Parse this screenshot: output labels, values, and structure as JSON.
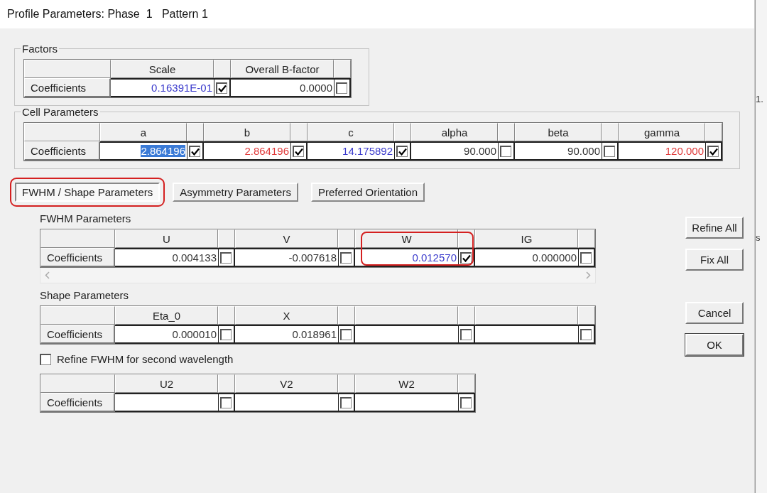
{
  "window": {
    "title": "Profile Parameters: Phase  1   Pattern 1"
  },
  "factors": {
    "title": "Factors",
    "row_label": "Coefficients",
    "columns": [
      {
        "label": "Scale",
        "value": "0.16391E-01",
        "color": "#3a3acc",
        "checked": true,
        "selected": false
      },
      {
        "label": "Overall B-factor",
        "value": "0.0000",
        "color": "#333333",
        "checked": false,
        "selected": false
      }
    ]
  },
  "cell_parameters": {
    "title": "Cell Parameters",
    "row_label": "Coefficients",
    "columns": [
      {
        "label": "a",
        "value": "2.864196",
        "checked": true,
        "selected": true
      },
      {
        "label": "b",
        "value": "2.864196",
        "color": "#e03a3a",
        "checked": true,
        "selected": false
      },
      {
        "label": "c",
        "value": "14.175892",
        "color": "#3a3acc",
        "checked": true,
        "selected": false
      },
      {
        "label": "alpha",
        "value": "90.000",
        "color": "#333333",
        "checked": false,
        "selected": false
      },
      {
        "label": "beta",
        "value": "90.000",
        "color": "#333333",
        "checked": false,
        "selected": false
      },
      {
        "label": "gamma",
        "value": "120.000",
        "color": "#e03a3a",
        "checked": true,
        "selected": false
      }
    ]
  },
  "tabs": [
    {
      "label": "FWHM / Shape Parameters",
      "selected": true,
      "annotated": true
    },
    {
      "label": "Asymmetry Parameters",
      "selected": false,
      "annotated": false
    },
    {
      "label": "Preferred Orientation",
      "selected": false,
      "annotated": false
    }
  ],
  "fwhm": {
    "title": "FWHM Parameters",
    "row_label": "Coefficients",
    "columns": [
      {
        "label": "U",
        "value": "0.004133",
        "color": "#333333",
        "checked": false,
        "annotated": false
      },
      {
        "label": "V",
        "value": "-0.007618",
        "color": "#333333",
        "checked": false,
        "annotated": false
      },
      {
        "label": "W",
        "value": "0.012570",
        "color": "#3a3acc",
        "checked": true,
        "annotated": true
      },
      {
        "label": "IG",
        "value": "0.000000",
        "color": "#333333",
        "checked": false,
        "annotated": false
      }
    ]
  },
  "shape": {
    "title": "Shape Parameters",
    "row_label": "Coefficients",
    "columns": [
      {
        "label": "Eta_0",
        "value": "0.000010",
        "color": "#333333",
        "checked": false
      },
      {
        "label": "X",
        "value": "0.018961",
        "color": "#333333",
        "checked": false
      },
      {
        "checked": false
      },
      {
        "checked": false
      }
    ]
  },
  "second_wavelength": {
    "label": "Refine FWHM for second wavelength",
    "checked": false
  },
  "second_wavelength_table": {
    "row_label": "Coefficients",
    "columns": [
      {
        "label": "U2",
        "checked": false
      },
      {
        "label": "V2",
        "checked": false
      },
      {
        "label": "W2",
        "checked": false
      }
    ]
  },
  "buttons": {
    "refine": [
      {
        "label": "Refine All",
        "default": false
      },
      {
        "label": "Fix All",
        "default": false
      }
    ],
    "dialog": [
      {
        "label": "Cancel",
        "default": false
      },
      {
        "label": "OK",
        "default": true
      }
    ]
  },
  "background_window": {
    "texts": [
      "1.",
      "s"
    ]
  }
}
